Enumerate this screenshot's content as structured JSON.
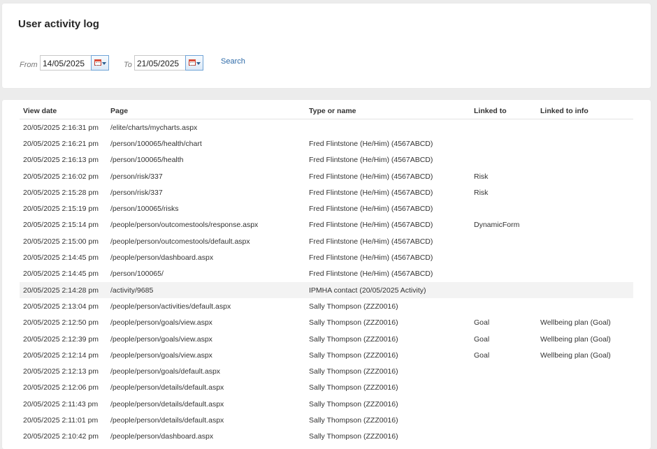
{
  "page": {
    "title": "User activity log"
  },
  "filter": {
    "from_label": "From",
    "from_value": "14/05/2025",
    "to_label": "To",
    "to_value": "21/05/2025",
    "search_label": "Search"
  },
  "table": {
    "headers": [
      "View date",
      "Page",
      "Type or name",
      "Linked to",
      "Linked to info"
    ],
    "rows": [
      [
        "20/05/2025 2:16:31 pm",
        "/elite/charts/mycharts.aspx",
        "",
        "",
        ""
      ],
      [
        "20/05/2025 2:16:21 pm",
        "/person/100065/health/chart",
        "Fred Flintstone (He/Him) (4567ABCD)",
        "",
        ""
      ],
      [
        "20/05/2025 2:16:13 pm",
        "/person/100065/health",
        "Fred Flintstone (He/Him) (4567ABCD)",
        "",
        ""
      ],
      [
        "20/05/2025 2:16:02 pm",
        "/person/risk/337",
        "Fred Flintstone (He/Him) (4567ABCD)",
        "Risk",
        ""
      ],
      [
        "20/05/2025 2:15:28 pm",
        "/person/risk/337",
        "Fred Flintstone (He/Him) (4567ABCD)",
        "Risk",
        ""
      ],
      [
        "20/05/2025 2:15:19 pm",
        "/person/100065/risks",
        "Fred Flintstone (He/Him) (4567ABCD)",
        "",
        ""
      ],
      [
        "20/05/2025 2:15:14 pm",
        "/people/person/outcomestools/response.aspx",
        "Fred Flintstone (He/Him) (4567ABCD)",
        "DynamicForm",
        ""
      ],
      [
        "20/05/2025 2:15:00 pm",
        "/people/person/outcomestools/default.aspx",
        "Fred Flintstone (He/Him) (4567ABCD)",
        "",
        ""
      ],
      [
        "20/05/2025 2:14:45 pm",
        "/people/person/dashboard.aspx",
        "Fred Flintstone (He/Him) (4567ABCD)",
        "",
        ""
      ],
      [
        "20/05/2025 2:14:45 pm",
        "/person/100065/",
        "Fred Flintstone (He/Him) (4567ABCD)",
        "",
        ""
      ],
      [
        "20/05/2025 2:14:28 pm",
        "/activity/9685",
        "IPMHA contact (20/05/2025 Activity)",
        "",
        ""
      ],
      [
        "20/05/2025 2:13:04 pm",
        "/people/person/activities/default.aspx",
        "Sally Thompson (ZZZ0016)",
        "",
        ""
      ],
      [
        "20/05/2025 2:12:50 pm",
        "/people/person/goals/view.aspx",
        "Sally Thompson (ZZZ0016)",
        "Goal",
        "Wellbeing plan (Goal)"
      ],
      [
        "20/05/2025 2:12:39 pm",
        "/people/person/goals/view.aspx",
        "Sally Thompson (ZZZ0016)",
        "Goal",
        "Wellbeing plan (Goal)"
      ],
      [
        "20/05/2025 2:12:14 pm",
        "/people/person/goals/view.aspx",
        "Sally Thompson (ZZZ0016)",
        "Goal",
        "Wellbeing plan (Goal)"
      ],
      [
        "20/05/2025 2:12:13 pm",
        "/people/person/goals/default.aspx",
        "Sally Thompson (ZZZ0016)",
        "",
        ""
      ],
      [
        "20/05/2025 2:12:06 pm",
        "/people/person/details/default.aspx",
        "Sally Thompson (ZZZ0016)",
        "",
        ""
      ],
      [
        "20/05/2025 2:11:43 pm",
        "/people/person/details/default.aspx",
        "Sally Thompson (ZZZ0016)",
        "",
        ""
      ],
      [
        "20/05/2025 2:11:01 pm",
        "/people/person/details/default.aspx",
        "Sally Thompson (ZZZ0016)",
        "",
        ""
      ],
      [
        "20/05/2025 2:10:42 pm",
        "/people/person/dashboard.aspx",
        "Sally Thompson (ZZZ0016)",
        "",
        ""
      ]
    ],
    "highlighted_row": 10
  },
  "icons": {
    "date_picker": "calendar-icon"
  }
}
